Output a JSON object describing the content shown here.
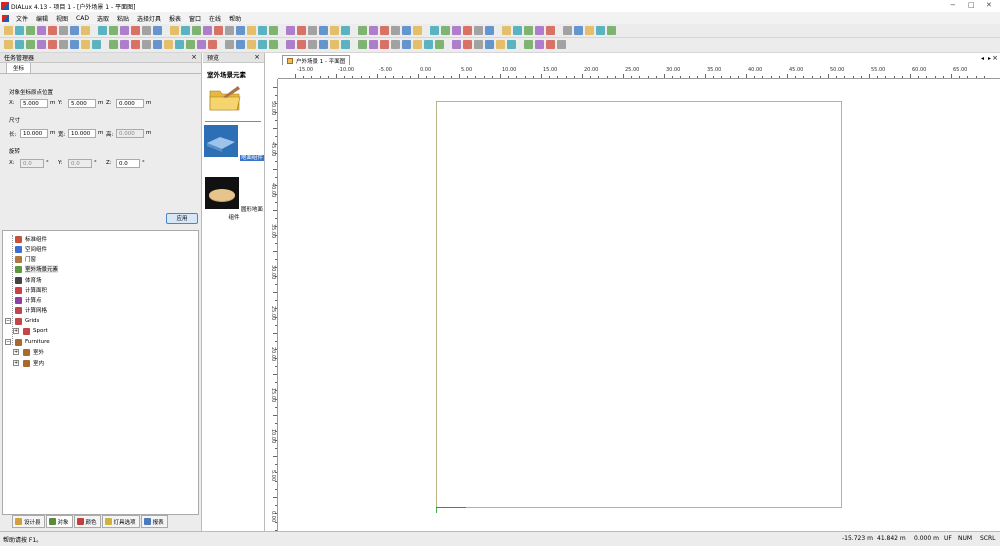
{
  "window": {
    "title": "DIALux 4.13 - 项目 1 - [户外场景 1 - 平面图]",
    "controls": [
      "−",
      "□",
      "✕"
    ]
  },
  "menu": [
    "文件",
    "编辑",
    "视图",
    "CAD",
    "选取",
    "粘贴",
    "选择灯具",
    "报表",
    "窗口",
    "在线",
    "帮助"
  ],
  "task_manager": {
    "title": "任务管理器",
    "tab": "坐标",
    "position_section": "对象坐标原点位置",
    "x_label": "X:",
    "x_value": "5.000",
    "y_label": "Y:",
    "y_value": "5.000",
    "z_label": "Z:",
    "z_value": "0.000",
    "unit_m": "m",
    "size_section": "尺寸",
    "length_label": "长:",
    "length_value": "10.000",
    "width_label": "宽:",
    "width_value": "10.000",
    "height_label": "高:",
    "height_value": "0.000",
    "rotation_section": "旋转",
    "rx_label": "X:",
    "rx_value": "0.0",
    "ry_label": "Y:",
    "ry_value": "0.0",
    "rz_label": "Z:",
    "rz_value": "0.0",
    "unit_deg": "°",
    "apply_label": "应用"
  },
  "tree": [
    {
      "label": "标准组件",
      "color": "#c8503c"
    },
    {
      "label": "空间组件",
      "color": "#3c6fd0"
    },
    {
      "label": "门窗",
      "color": "#b07840"
    },
    {
      "label": "室外场景元素",
      "color": "#5a9a3c"
    },
    {
      "label": "体育场",
      "color": "#444444"
    },
    {
      "label": "计算面积",
      "color": "#d04040"
    },
    {
      "label": "计算点",
      "color": "#9040a0"
    },
    {
      "label": "计算网格",
      "color": "#c04848"
    },
    {
      "label": "Grids",
      "color": "#c04848"
    },
    {
      "label": "Sport",
      "color": "#c04848"
    },
    {
      "label": "Furniture",
      "color": "#a86a2c"
    },
    {
      "label": "室外",
      "color": "#a86a2c"
    },
    {
      "label": "室内",
      "color": "#a86a2c"
    }
  ],
  "bottom_tabs": [
    {
      "label": "设计县",
      "color": "#d0a040"
    },
    {
      "label": "对象",
      "color": "#5a8a3c"
    },
    {
      "label": "颜色",
      "color": "#c04040"
    },
    {
      "label": "灯具选项",
      "color": "#d0b040"
    },
    {
      "label": "报表",
      "color": "#4a7ac0"
    }
  ],
  "preview": {
    "title": "预览",
    "heading": "室外场景元素",
    "item1": "地面组件",
    "item2": "圆形地面组件"
  },
  "document": {
    "tab": "户外场景 1 - 平面图"
  },
  "ruler_h": [
    "-15.00",
    "-10.00",
    "-5.00",
    "0.00",
    "5.00",
    "10.00",
    "15.00",
    "20.00",
    "25.00",
    "30.00",
    "35.00",
    "40.00",
    "45.00",
    "50.00",
    "55.00",
    "60.00",
    "65.00"
  ],
  "ruler_v": [
    "50.00",
    "45.00",
    "40.00",
    "35.00",
    "30.00",
    "25.00",
    "20.00",
    "15.00",
    "10.00",
    "5.00",
    "0.00"
  ],
  "status": {
    "help": "帮助请按 F1。",
    "x": "-15.723 m",
    "y": "41.842 m",
    "z": "0.000 m",
    "uf": "UF",
    "num": "NUM",
    "scrl": "SCRL"
  },
  "colors": {
    "accent": "#4a86c6",
    "room_outline": "#b8b48a"
  }
}
